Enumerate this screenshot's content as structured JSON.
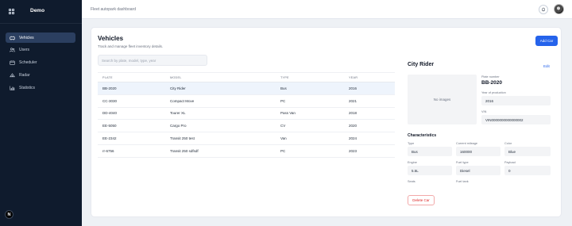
{
  "app": {
    "name": "Demo"
  },
  "sidebar": {
    "items": [
      {
        "label": "Vehicles",
        "icon": "car-icon",
        "active": true
      },
      {
        "label": "Users",
        "icon": "users-icon",
        "active": false
      },
      {
        "label": "Scheduler",
        "icon": "calendar-icon",
        "active": false
      },
      {
        "label": "Radar",
        "icon": "radar-icon",
        "active": false
      },
      {
        "label": "Statistics",
        "icon": "chart-icon",
        "active": false
      }
    ],
    "badge": "N"
  },
  "header": {
    "title": "Fleet autopark dashboard"
  },
  "page": {
    "title": "Vehicles",
    "subtitle": "Track and manage fleet inventory details.",
    "add_button": "Add Car",
    "search_placeholder": "Search by plate, model, type, year"
  },
  "table": {
    "columns": [
      "PLATE",
      "MODEL",
      "TYPE",
      "YEAR"
    ],
    "rows": [
      {
        "plate": "BB-2020",
        "model": "City Rider",
        "type": "Bus",
        "year": "2016",
        "selected": true
      },
      {
        "plate": "CC-3030",
        "model": "Compact Move",
        "type": "PC",
        "year": "2021"
      },
      {
        "plate": "DD-4040",
        "model": "Tourer XL",
        "type": "Pass Van",
        "year": "2018"
      },
      {
        "plate": "EE-5050",
        "model": "Cargo Pro",
        "type": "CV",
        "year": "2020"
      },
      {
        "plate": "EE-2342",
        "model": "Transit 250 test",
        "type": "Van",
        "year": "2024"
      },
      {
        "plate": "rr-6756",
        "model": "Transit 250 sdfsdf",
        "type": "PC",
        "year": "2023"
      }
    ]
  },
  "detail": {
    "title": "City Rider",
    "edit_label": "Edit",
    "no_images": "No images",
    "plate_label": "Plate number",
    "plate": "BB-2020",
    "year_label": "Year of production",
    "year": "2016",
    "vin_label": "VIN",
    "vin": "VIN0000000000000002",
    "characteristics_title": "Characteristics",
    "fields": [
      {
        "label": "Type",
        "value": "Bus"
      },
      {
        "label": "Current mileage",
        "value": "160000"
      },
      {
        "label": "Color",
        "value": "Blue"
      },
      {
        "label": "Engine",
        "value": "5.5L"
      },
      {
        "label": "Fuel type",
        "value": "Diesel"
      },
      {
        "label": "Payload",
        "value": "0"
      },
      {
        "label": "Seats",
        "value": ""
      },
      {
        "label": "Fuel tank",
        "value": ""
      }
    ],
    "delete_button": "Delete Car"
  },
  "colors": {
    "sidebar_bg": "#0f1b2d",
    "active_nav": "#2b3f60",
    "accent": "#2563eb",
    "danger": "#dc2626",
    "selected_row": "#eef4fc"
  }
}
